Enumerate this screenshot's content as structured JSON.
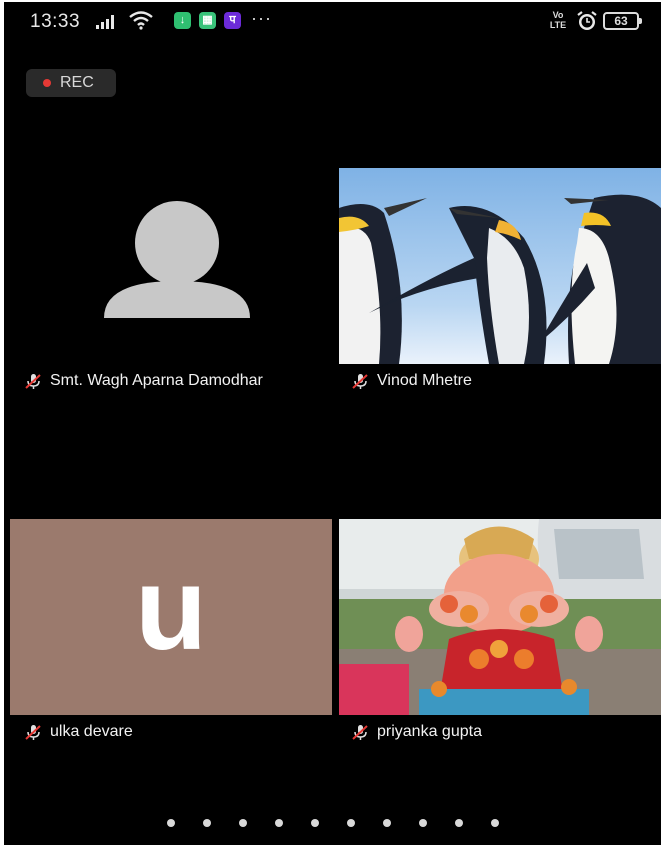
{
  "status_bar": {
    "time": "13:33",
    "more": "···",
    "network": "Vo LTE",
    "battery": "63",
    "icons": [
      "signal-icon",
      "wifi-icon",
      "download-app-icon",
      "app-icon",
      "phonepe-icon",
      "alarm-icon",
      "battery-icon"
    ]
  },
  "recording": {
    "label": "REC",
    "indicator_color": "#e53935"
  },
  "participants": [
    {
      "name": "Smt. Wagh Aparna Damodhar",
      "muted": true,
      "video": "default-avatar"
    },
    {
      "name": "Vinod Mhetre",
      "muted": true,
      "video": "penguins-photo"
    },
    {
      "name": "ulka devare",
      "muted": true,
      "video": "initial-avatar",
      "initial": "u",
      "avatar_color": "#9b7a6d"
    },
    {
      "name": "priyanka gupta",
      "muted": true,
      "video": "ganesha-idol-photo"
    }
  ],
  "pager": {
    "pages": 10
  }
}
